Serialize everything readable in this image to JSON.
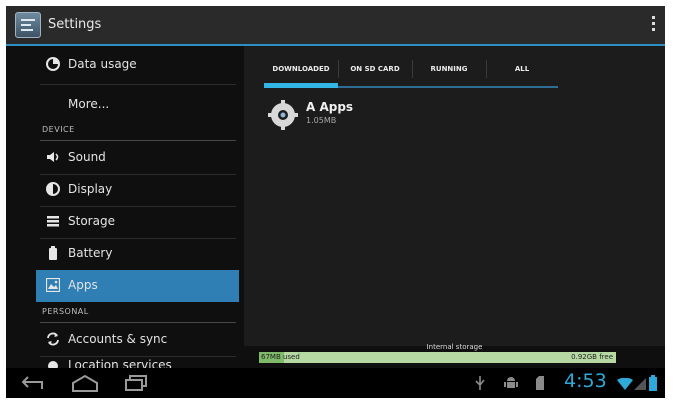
{
  "window": {
    "title": "Settings"
  },
  "sidebar": {
    "items": [
      {
        "label": "Data usage",
        "icon": "data-usage-icon"
      },
      {
        "label": "More..."
      },
      {
        "label": "Sound",
        "icon": "sound-icon"
      },
      {
        "label": "Display",
        "icon": "display-icon"
      },
      {
        "label": "Storage",
        "icon": "storage-icon"
      },
      {
        "label": "Battery",
        "icon": "battery-icon"
      },
      {
        "label": "Apps",
        "icon": "apps-icon",
        "selected": true
      },
      {
        "label": "Accounts & sync",
        "icon": "sync-icon"
      },
      {
        "label": "Location services",
        "icon": "location-icon"
      }
    ],
    "headers": {
      "device": "DEVICE",
      "personal": "PERSONAL"
    }
  },
  "apps": {
    "tabs": [
      "DOWNLOADED",
      "ON SD CARD",
      "RUNNING",
      "ALL"
    ],
    "selected_tab": "DOWNLOADED",
    "list": [
      {
        "name": "A Apps",
        "size": "1.05MB",
        "icon": "app-gear-icon"
      }
    ]
  },
  "storage": {
    "title": "Internal storage",
    "used_label": "67MB used",
    "free_label": "0.92GB free",
    "used_fraction": 0.07
  },
  "statusbar": {
    "time": "4:53"
  },
  "colors": {
    "accent": "#33b5e5",
    "selected_row": "#2f7fb5",
    "storage_bar": "#b6d9a4"
  }
}
